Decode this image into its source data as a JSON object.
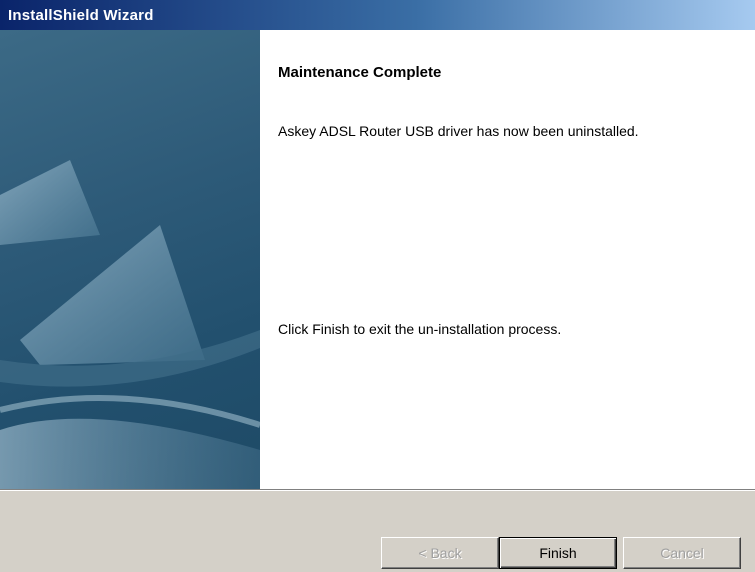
{
  "window": {
    "title": "InstallShield Wizard"
  },
  "content": {
    "heading": "Maintenance Complete",
    "message": "Askey ADSL Router USB driver has now been uninstalled.",
    "instruction": "Click Finish to exit the un-installation process."
  },
  "buttons": {
    "back": "< Back",
    "finish": "Finish",
    "cancel": "Cancel"
  },
  "colors": {
    "titlebar_start": "#0a246a",
    "titlebar_end": "#a6caf0",
    "panel": "#2d5a78",
    "dialog_face": "#d4d0c8"
  },
  "side_panel": {
    "image": "sail-boats-artwork"
  }
}
